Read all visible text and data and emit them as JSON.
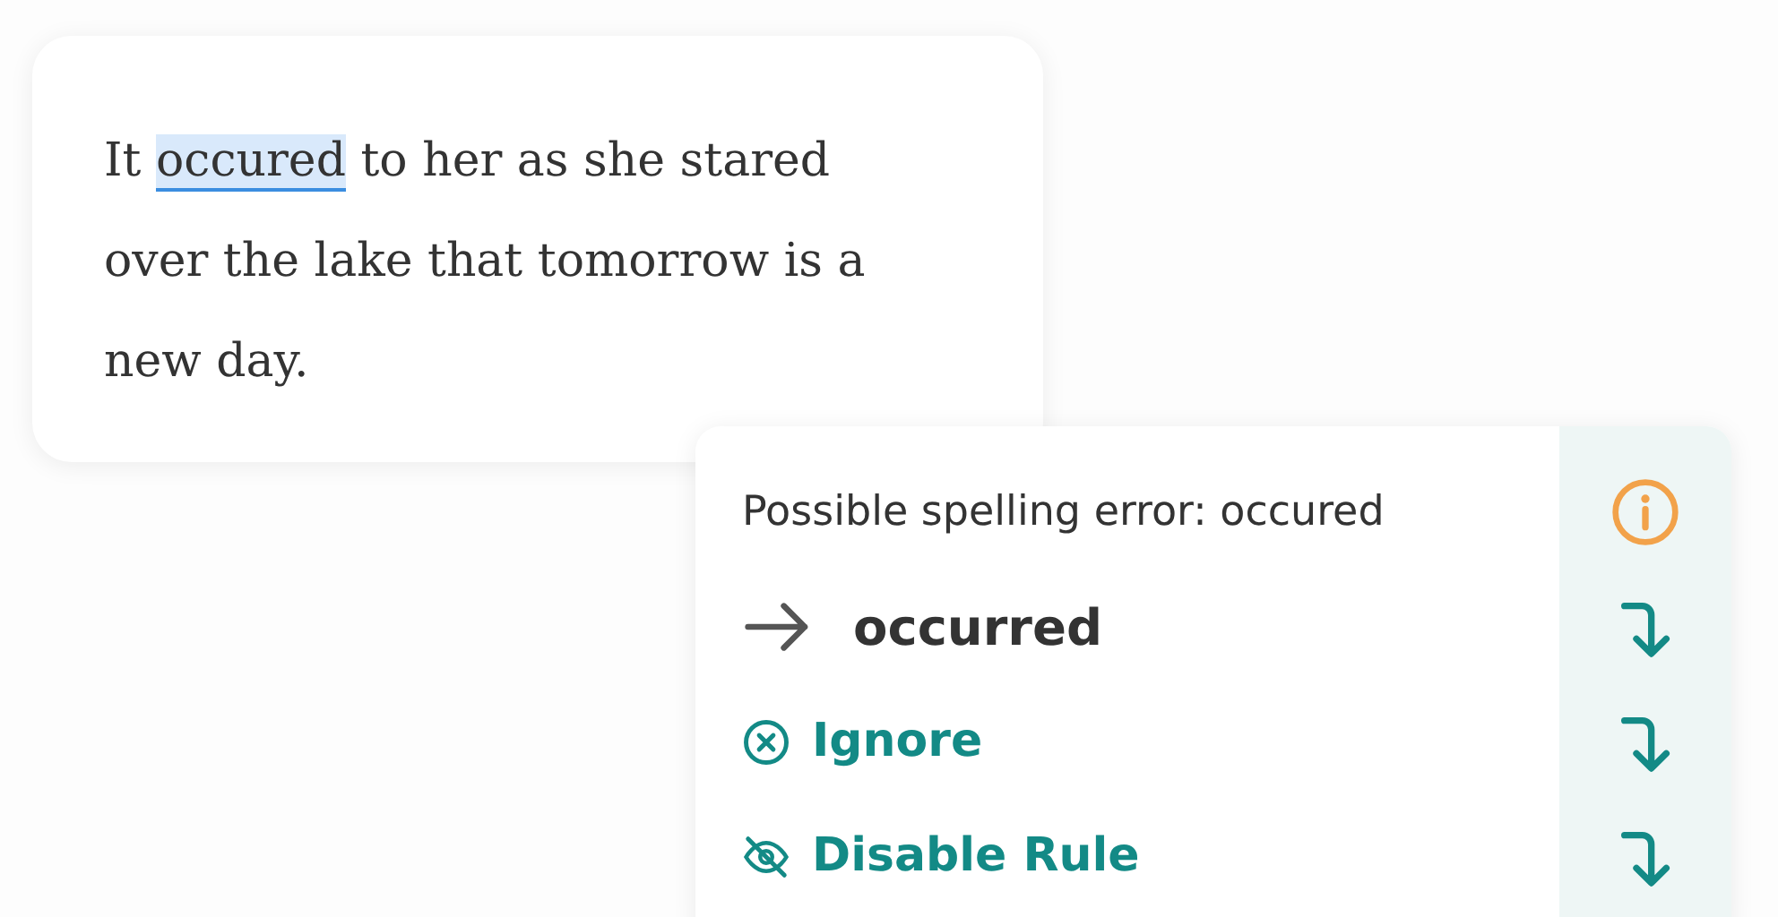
{
  "editor": {
    "paragraph": [
      {
        "text": "It ",
        "flagged": false
      },
      {
        "text": "occured",
        "flagged": true
      },
      {
        "text": " to her as she stared over the lake that tomorrow is a new day.",
        "flagged": false
      }
    ]
  },
  "popup": {
    "message": "Possible spelling error: occured",
    "rows": [
      {
        "kind": "suggestion",
        "label": "occurred"
      },
      {
        "kind": "ignore",
        "label": "Ignore"
      },
      {
        "kind": "disable",
        "label": "Disable Rule"
      }
    ]
  }
}
